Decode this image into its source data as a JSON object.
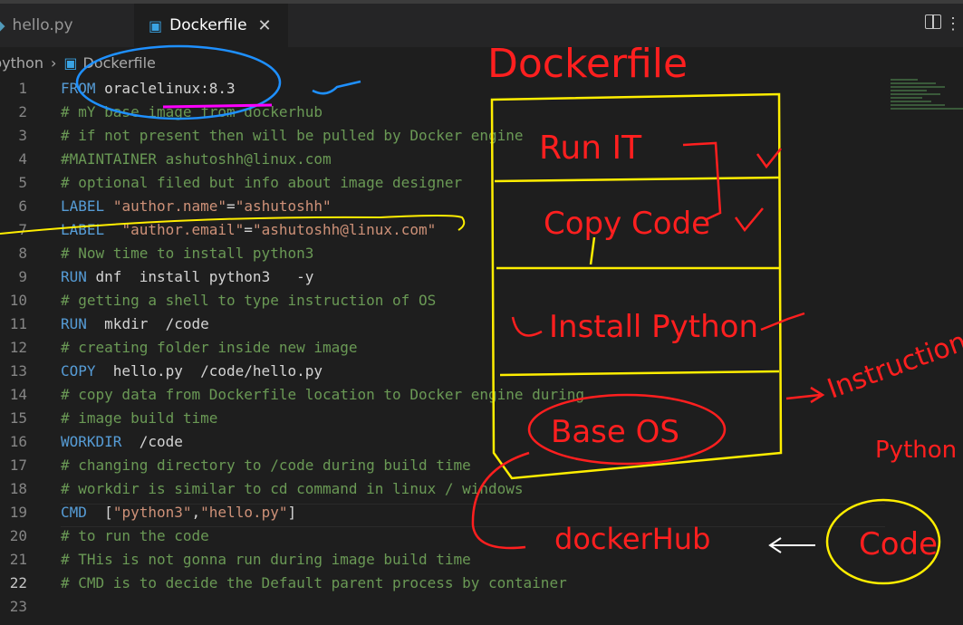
{
  "tabs": [
    {
      "label": "hello.py",
      "active": false
    },
    {
      "label": "Dockerfile",
      "active": true
    }
  ],
  "breadcrumb": [
    "python",
    "Dockerfile"
  ],
  "lines": [
    {
      "n": "1",
      "tokens": [
        {
          "t": "FROM",
          "c": "kw"
        },
        {
          "t": " oraclelinux:8.3",
          "c": "plain"
        }
      ]
    },
    {
      "n": "2",
      "tokens": [
        {
          "t": "# mY base image from dockerhub",
          "c": "cm"
        }
      ]
    },
    {
      "n": "3",
      "tokens": [
        {
          "t": "# if not present then will be pulled by Docker engine",
          "c": "cm"
        }
      ]
    },
    {
      "n": "4",
      "tokens": [
        {
          "t": "#MAINTAINER ashutoshh@linux.com",
          "c": "cm"
        }
      ]
    },
    {
      "n": "5",
      "tokens": [
        {
          "t": "# optional filed but info about image designer",
          "c": "cm"
        }
      ]
    },
    {
      "n": "6",
      "tokens": [
        {
          "t": "LABEL",
          "c": "kw"
        },
        {
          "t": " ",
          "c": "plain"
        },
        {
          "t": "\"author.name\"",
          "c": "str"
        },
        {
          "t": "=",
          "c": "plain"
        },
        {
          "t": "\"ashutoshh\"",
          "c": "str"
        }
      ]
    },
    {
      "n": "7",
      "tokens": [
        {
          "t": "LABEL",
          "c": "kw"
        },
        {
          "t": "  ",
          "c": "plain"
        },
        {
          "t": "\"author.email\"",
          "c": "str"
        },
        {
          "t": "=",
          "c": "plain"
        },
        {
          "t": "\"ashutoshh@linux.com\"",
          "c": "str"
        }
      ]
    },
    {
      "n": "8",
      "tokens": [
        {
          "t": "# Now time to install python3",
          "c": "cm"
        }
      ]
    },
    {
      "n": "9",
      "tokens": [
        {
          "t": "RUN",
          "c": "kw"
        },
        {
          "t": " dnf  install python3   -y",
          "c": "plain"
        }
      ]
    },
    {
      "n": "10",
      "tokens": [
        {
          "t": "# getting a shell to type instruction of OS",
          "c": "cm"
        }
      ]
    },
    {
      "n": "11",
      "tokens": [
        {
          "t": "RUN",
          "c": "kw"
        },
        {
          "t": "  mkdir  /code",
          "c": "plain"
        }
      ]
    },
    {
      "n": "12",
      "tokens": [
        {
          "t": "# creating folder inside new image",
          "c": "cm"
        }
      ]
    },
    {
      "n": "13",
      "tokens": [
        {
          "t": "COPY",
          "c": "kw"
        },
        {
          "t": "  hello.py  /code/hello.py",
          "c": "plain"
        }
      ]
    },
    {
      "n": "14",
      "tokens": [
        {
          "t": "# copy data from Dockerfile location to Docker engine during",
          "c": "cm"
        }
      ]
    },
    {
      "n": "15",
      "tokens": [
        {
          "t": "# image build time",
          "c": "cm"
        }
      ]
    },
    {
      "n": "16",
      "tokens": [
        {
          "t": "WORKDIR",
          "c": "kw"
        },
        {
          "t": "  /code",
          "c": "plain"
        }
      ]
    },
    {
      "n": "17",
      "tokens": [
        {
          "t": "# changing directory to /code during build time",
          "c": "cm"
        }
      ]
    },
    {
      "n": "18",
      "tokens": [
        {
          "t": "# workdir is similar to cd command in linux / windows",
          "c": "cm"
        }
      ]
    },
    {
      "n": "19",
      "tokens": [
        {
          "t": "CMD",
          "c": "kw"
        },
        {
          "t": "  [",
          "c": "plain"
        },
        {
          "t": "\"python3\"",
          "c": "str"
        },
        {
          "t": ",",
          "c": "plain"
        },
        {
          "t": "\"hello.py\"",
          "c": "str"
        },
        {
          "t": "]",
          "c": "plain"
        }
      ]
    },
    {
      "n": "20",
      "tokens": [
        {
          "t": "# to run the code",
          "c": "cm"
        }
      ]
    },
    {
      "n": "21",
      "tokens": [
        {
          "t": "# THis is not gonna run during image build time",
          "c": "cm"
        }
      ]
    },
    {
      "n": "22",
      "tokens": [
        {
          "t": "# CMD is to decide the Default parent process by container",
          "c": "cm"
        }
      ]
    },
    {
      "n": "23",
      "tokens": []
    }
  ],
  "current_line": "22",
  "annotations": {
    "title": "Dockerfile",
    "layers": [
      "Run IT",
      "Copy Code",
      "Install Python",
      "Base OS"
    ],
    "instruction": "Instruction",
    "dockerhub": "dockerHub",
    "python": "Python",
    "code": "Code"
  },
  "colors": {
    "keyword": "#569cd6",
    "comment": "#6a9955",
    "string": "#ce9178",
    "ink_red": "#ff1f1f",
    "ink_yellow": "#ffee00",
    "ink_blue": "#1e90ff"
  }
}
